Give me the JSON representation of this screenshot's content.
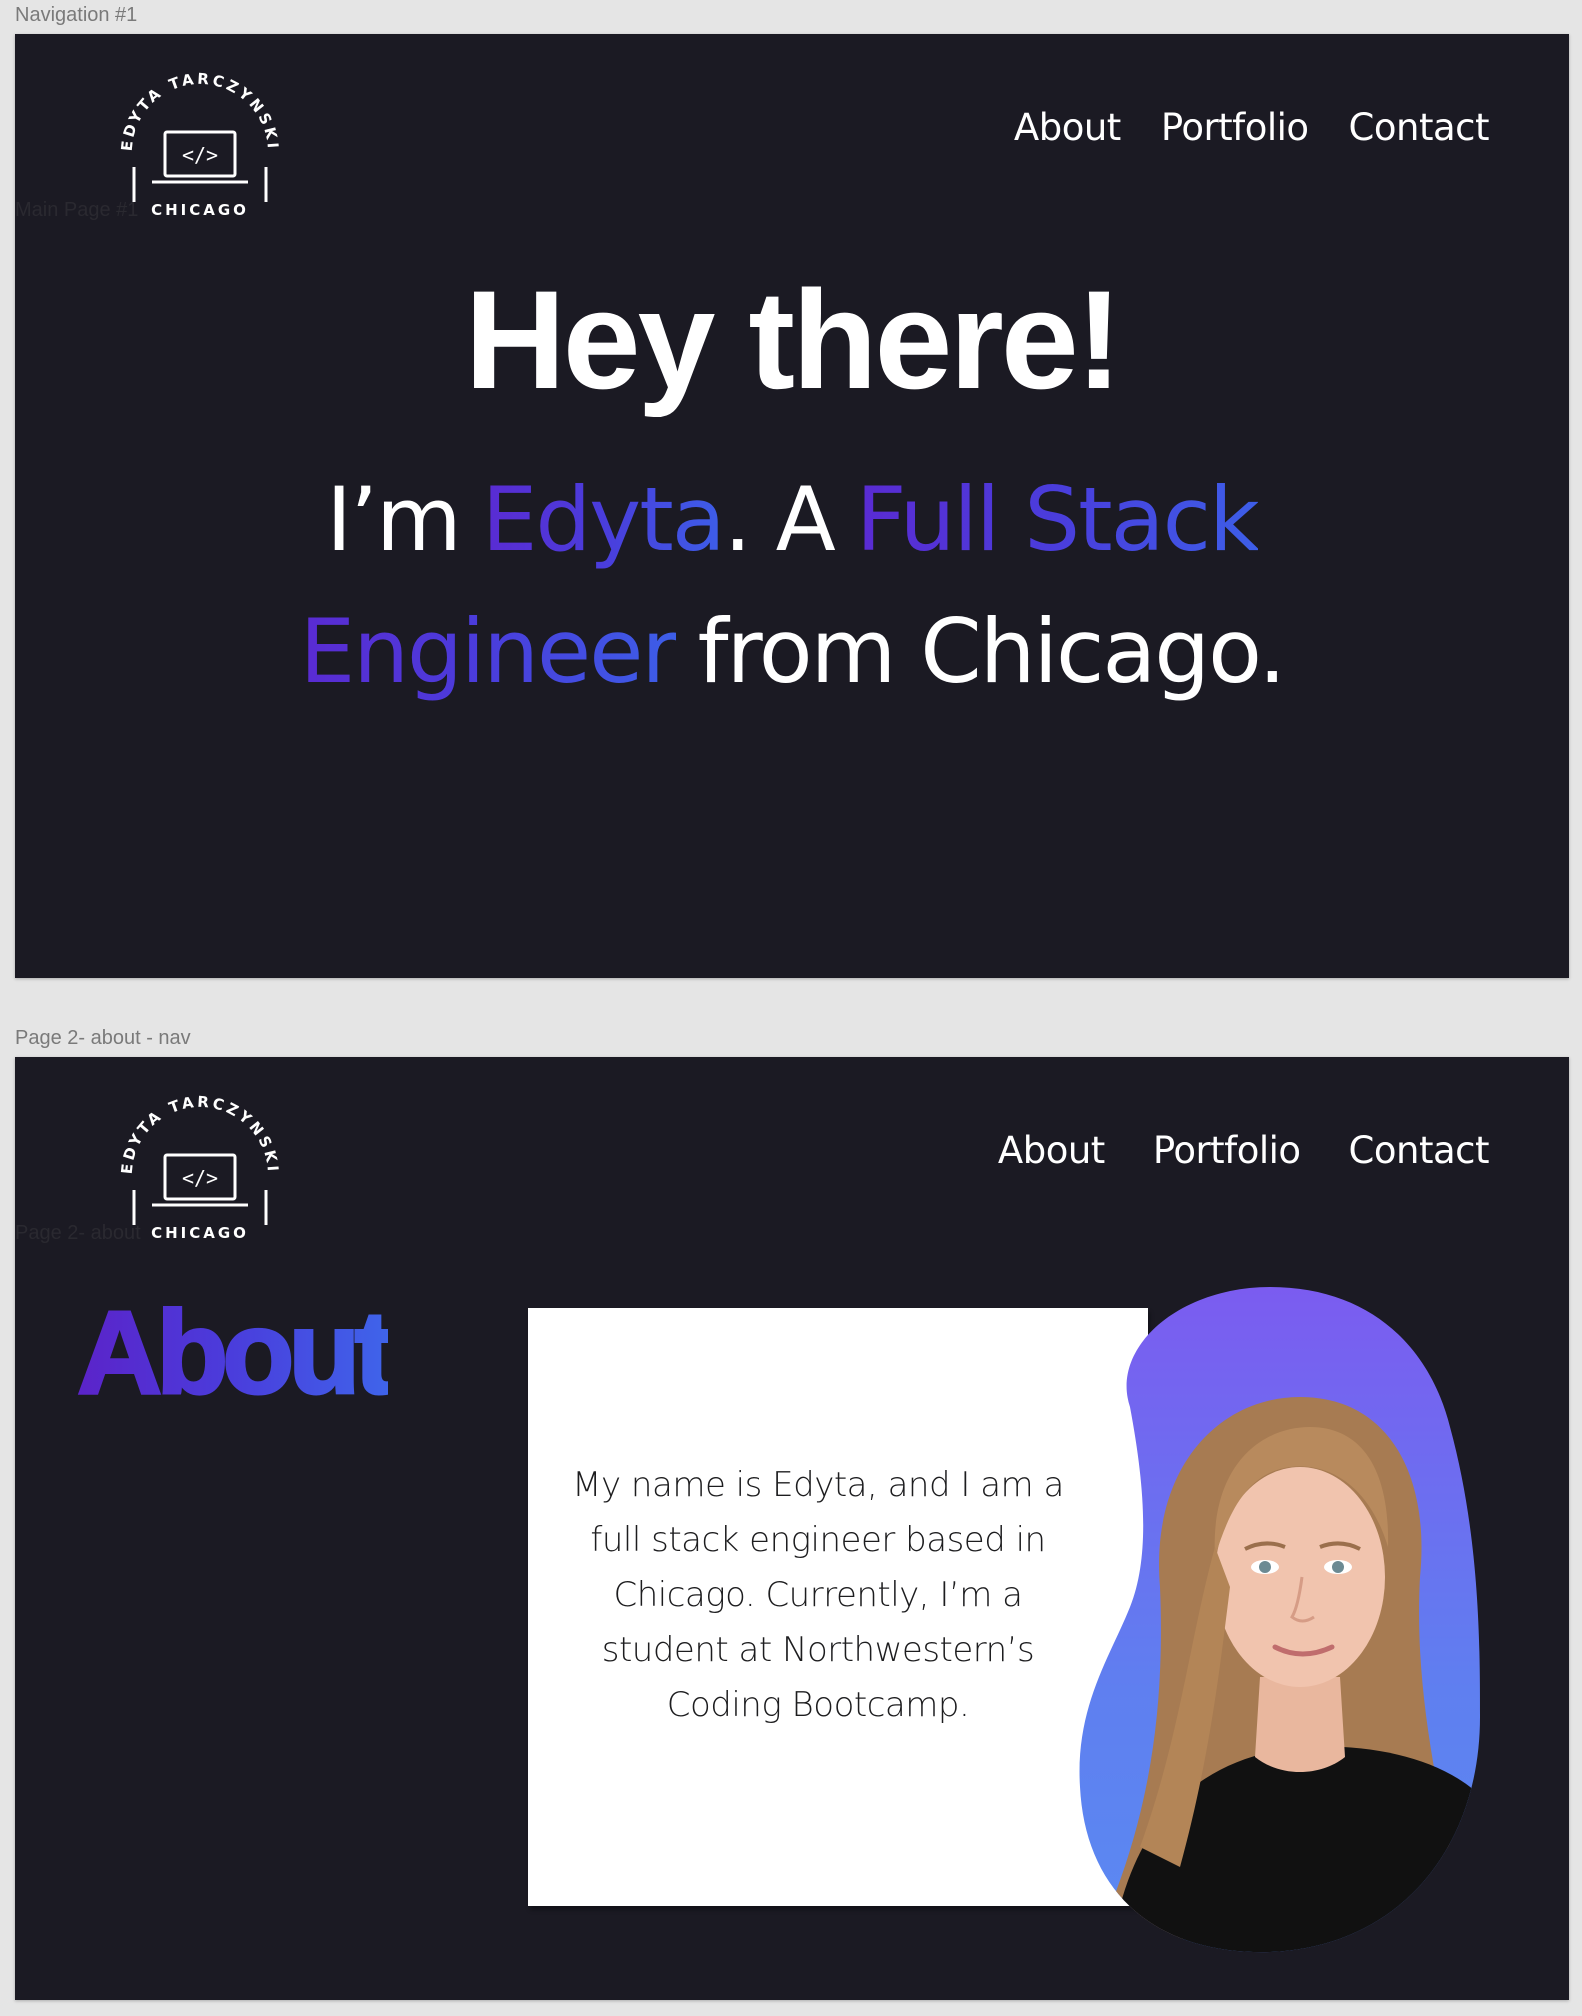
{
  "frames": {
    "navigation": {
      "label": "Navigation #1",
      "inner_label": "Main Page #1"
    },
    "about_page": {
      "label": "Page 2- about - nav",
      "inner_label": "Page 2- about"
    }
  },
  "logo": {
    "name": "EDYTA TARCZYNSKI",
    "city": "CHICAGO",
    "code_symbol": "</>"
  },
  "nav": {
    "items": [
      "About",
      "Portfolio",
      "Contact"
    ]
  },
  "hero": {
    "title": "Hey there!",
    "im": "I’m",
    "name": "Edyta",
    "period_a": ". A",
    "role_1": "Full Stack",
    "role_2": "Engineer",
    "from": "from Chicago."
  },
  "about": {
    "heading": "About",
    "bio": "My name is Edyta, and I am a full stack engineer based in Chicago. Currently, I’m a student at Northwestern’s Coding Bootcamp."
  },
  "colors": {
    "background": "#1b1a23",
    "gradient_start": "#5a2bd2",
    "gradient_end": "#3d5ee8",
    "text": "#ffffff",
    "canvas": "#e5e5e5"
  }
}
